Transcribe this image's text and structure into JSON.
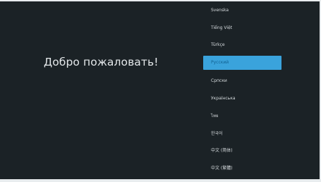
{
  "welcome_text": "Добро пожаловать!",
  "languages": [
    {
      "label": "Svenska"
    },
    {
      "label": "Tiếng Việt"
    },
    {
      "label": "Türkçe"
    },
    {
      "label": "Русский",
      "selected": true
    },
    {
      "label": "Српски"
    },
    {
      "label": "Українська"
    },
    {
      "label": "ไทย"
    },
    {
      "label": "한국어"
    },
    {
      "label": "中文 (简体)"
    },
    {
      "label": "中文 (繁體)"
    }
  ],
  "colors": {
    "background": "#1b2226",
    "selected_item": "#3aa3dc",
    "text": "#d6dbde"
  }
}
